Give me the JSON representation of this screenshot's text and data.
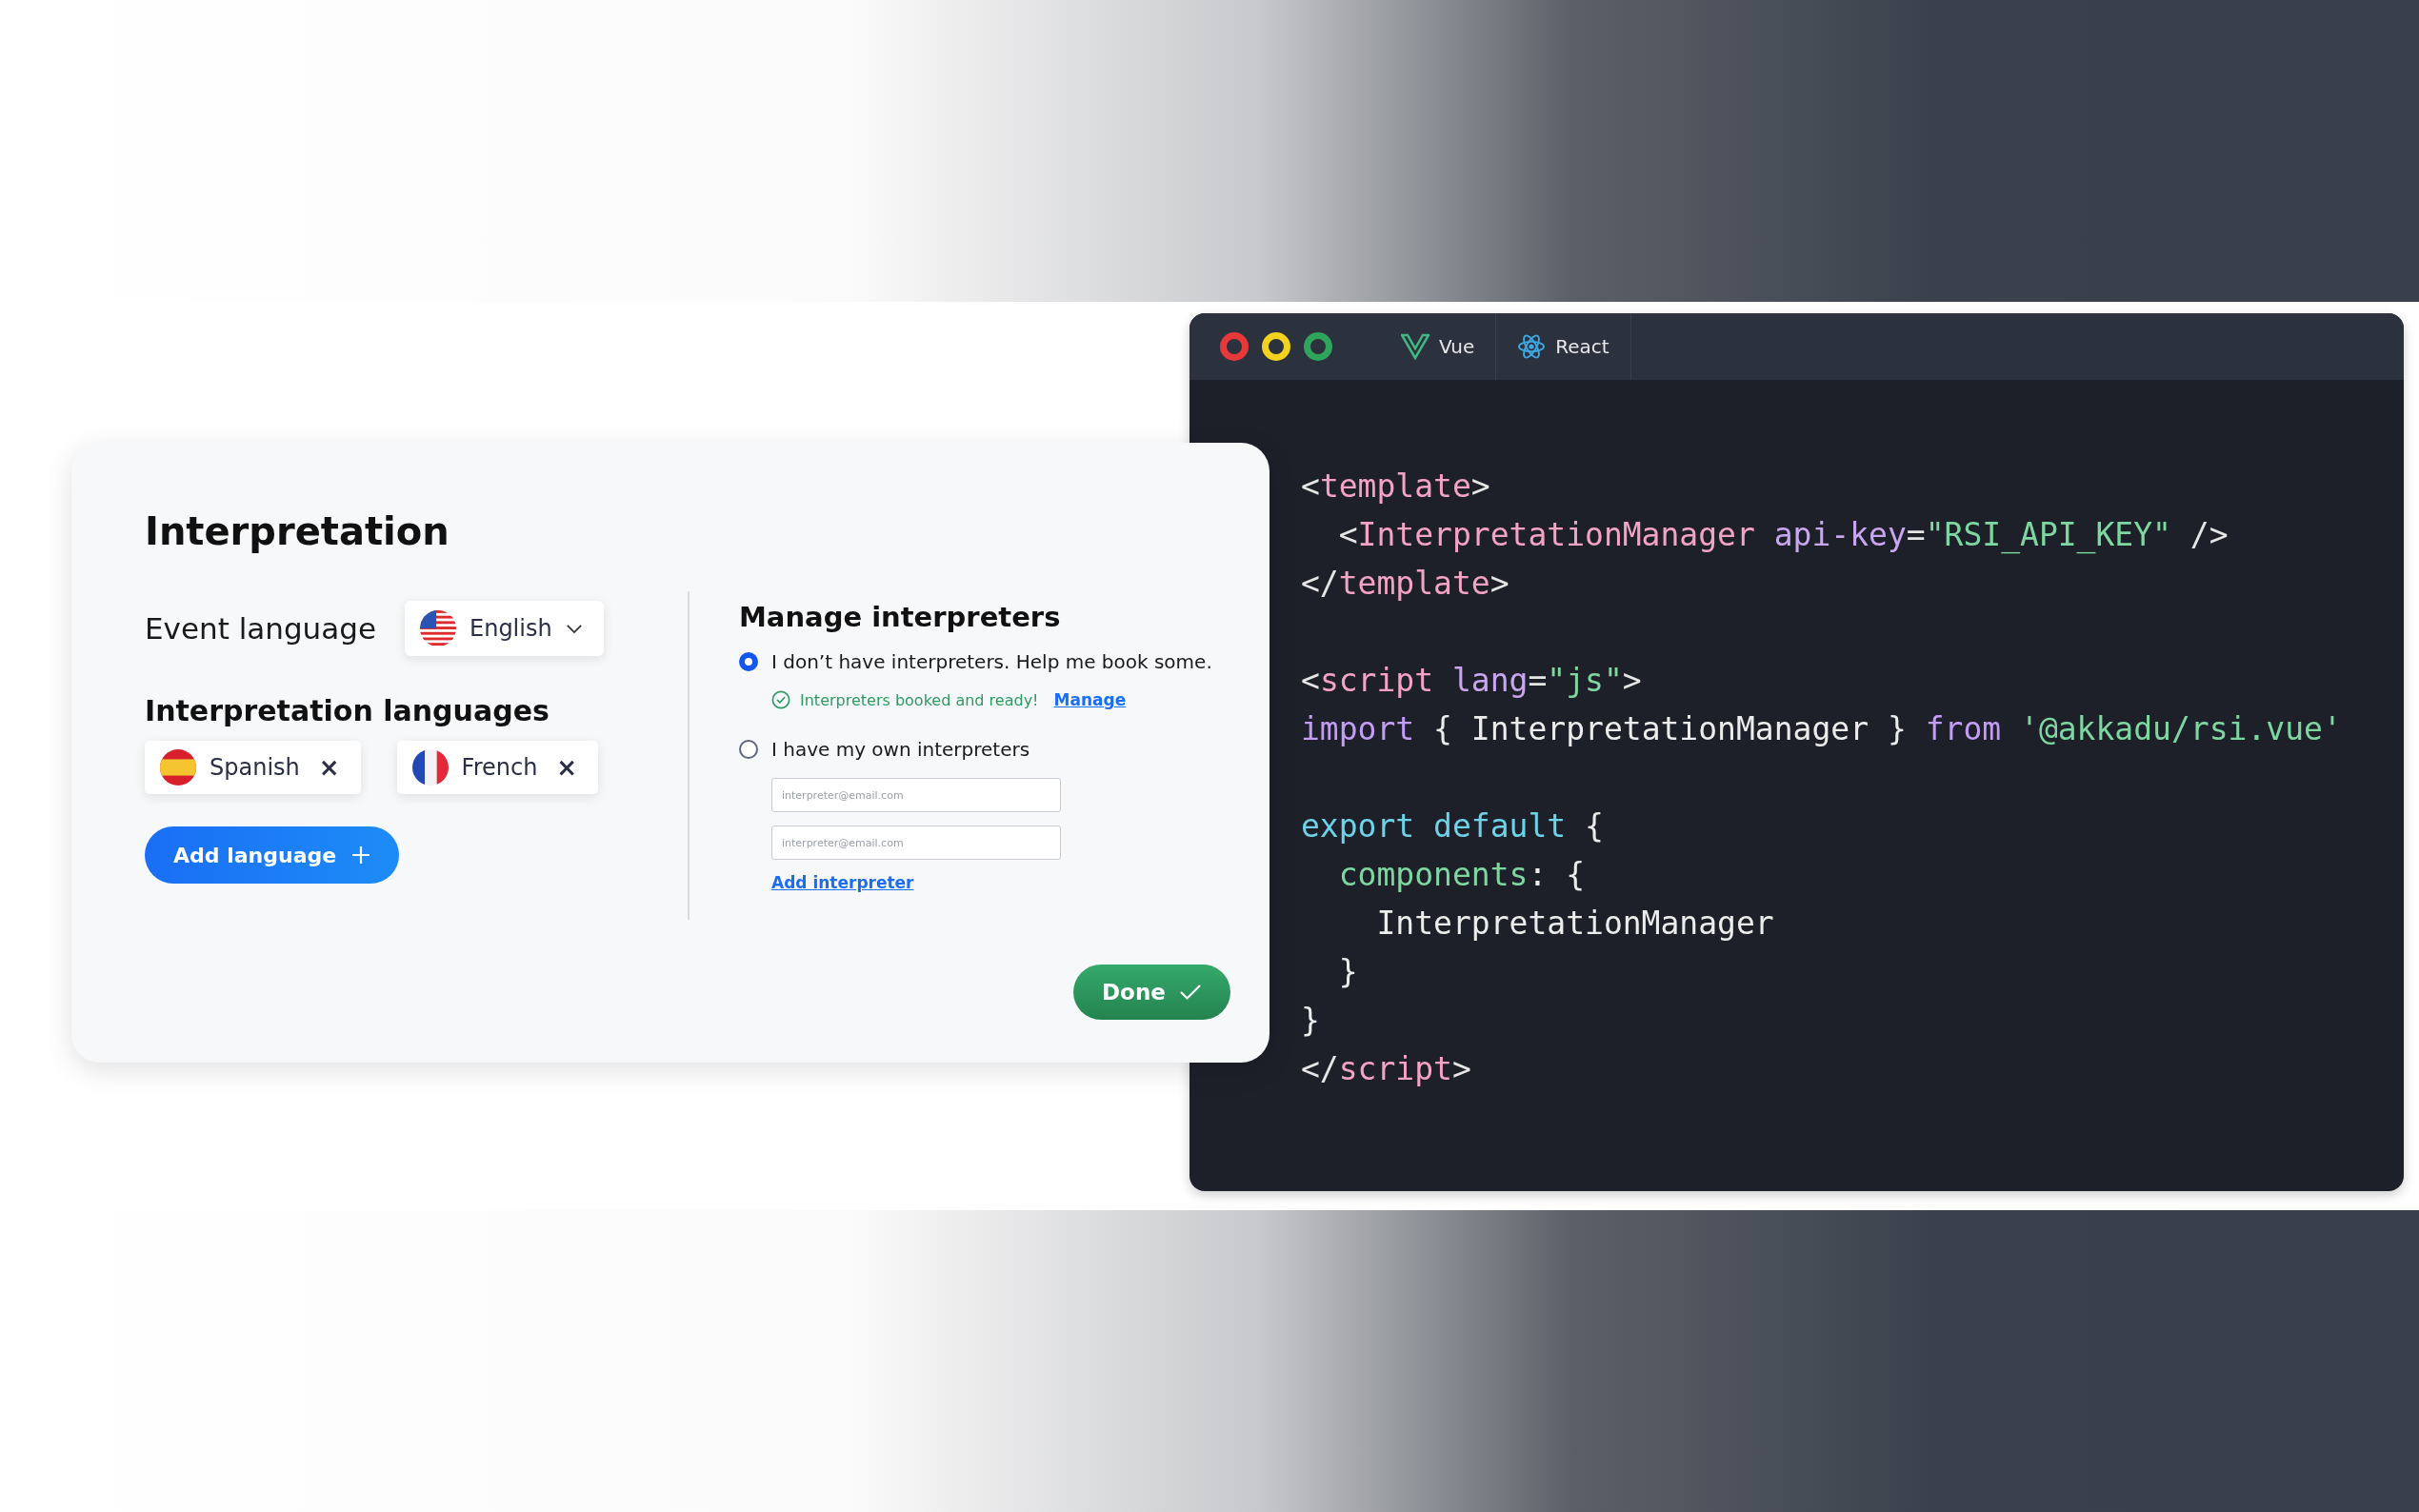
{
  "card": {
    "title": "Interpretation",
    "event_language": {
      "label": "Event language",
      "value": "English",
      "kind": "us"
    },
    "languages": {
      "heading": "Interpretation languages",
      "items": [
        {
          "name": "Spanish",
          "kind": "es",
          "remove": "×"
        },
        {
          "name": "French",
          "kind": "fr",
          "remove": "×"
        }
      ],
      "add_button": "Add language"
    },
    "interpreters": {
      "heading": "Manage interpreters",
      "options": [
        {
          "label": "I don’t have interpreters. Help me book some.",
          "selected": true,
          "status": "Interpreters booked and ready!",
          "link": "Manage"
        },
        {
          "label": "I have my own interpreters",
          "selected": false,
          "inputs": [
            {
              "placeholder": "interpreter@email.com"
            },
            {
              "placeholder": "interpreter@email.com"
            }
          ],
          "link": "Add interpreter"
        }
      ]
    },
    "done_button": "Done"
  },
  "code_window": {
    "tabs": [
      {
        "label": "Vue",
        "kind": "vue"
      },
      {
        "label": "React",
        "kind": "react"
      }
    ],
    "lines": [
      {
        "tokens": [
          {
            "t": "<",
            "kind": "punct"
          },
          {
            "t": "template",
            "kind": "tag"
          },
          {
            "t": ">",
            "kind": "punct"
          }
        ]
      },
      {
        "tokens": [
          {
            "t": "  <",
            "kind": "punct"
          },
          {
            "t": "InterpretationManager",
            "kind": "tag"
          },
          {
            "t": " api-key",
            "kind": "attr"
          },
          {
            "t": "=",
            "kind": "punct"
          },
          {
            "t": "\"RSI_API_KEY\"",
            "kind": "string"
          },
          {
            "t": " />",
            "kind": "punct"
          }
        ]
      },
      {
        "tokens": [
          {
            "t": "</",
            "kind": "punct"
          },
          {
            "t": "template",
            "kind": "tag"
          },
          {
            "t": ">",
            "kind": "punct"
          }
        ]
      },
      {
        "blank_before": true,
        "tokens": [
          {
            "t": "<",
            "kind": "punct"
          },
          {
            "t": "script",
            "kind": "tag"
          },
          {
            "t": " lang",
            "kind": "attr"
          },
          {
            "t": "=",
            "kind": "punct"
          },
          {
            "t": "\"js\"",
            "kind": "string"
          },
          {
            "t": ">",
            "kind": "punct"
          }
        ]
      },
      {
        "tokens": [
          {
            "t": "import",
            "kind": "keyword"
          },
          {
            "t": " { InterpretationManager } ",
            "kind": "plain"
          },
          {
            "t": "from",
            "kind": "keyword"
          },
          {
            "t": " '@akkadu/rsi.vue'",
            "kind": "string"
          }
        ]
      },
      {
        "blank_before": true,
        "tokens": [
          {
            "t": "export default",
            "kind": "export"
          },
          {
            "t": " {",
            "kind": "plain"
          }
        ]
      },
      {
        "tokens": [
          {
            "t": "  components",
            "kind": "prop"
          },
          {
            "t": ": {",
            "kind": "plain"
          }
        ]
      },
      {
        "tokens": [
          {
            "t": "    InterpretationManager",
            "kind": "plain"
          }
        ]
      },
      {
        "tokens": [
          {
            "t": "  }",
            "kind": "plain"
          }
        ]
      },
      {
        "tokens": [
          {
            "t": "}",
            "kind": "plain"
          }
        ]
      },
      {
        "tokens": [
          {
            "t": "</",
            "kind": "punct"
          },
          {
            "t": "script",
            "kind": "tag"
          },
          {
            "t": ">",
            "kind": "punct"
          }
        ]
      }
    ]
  }
}
